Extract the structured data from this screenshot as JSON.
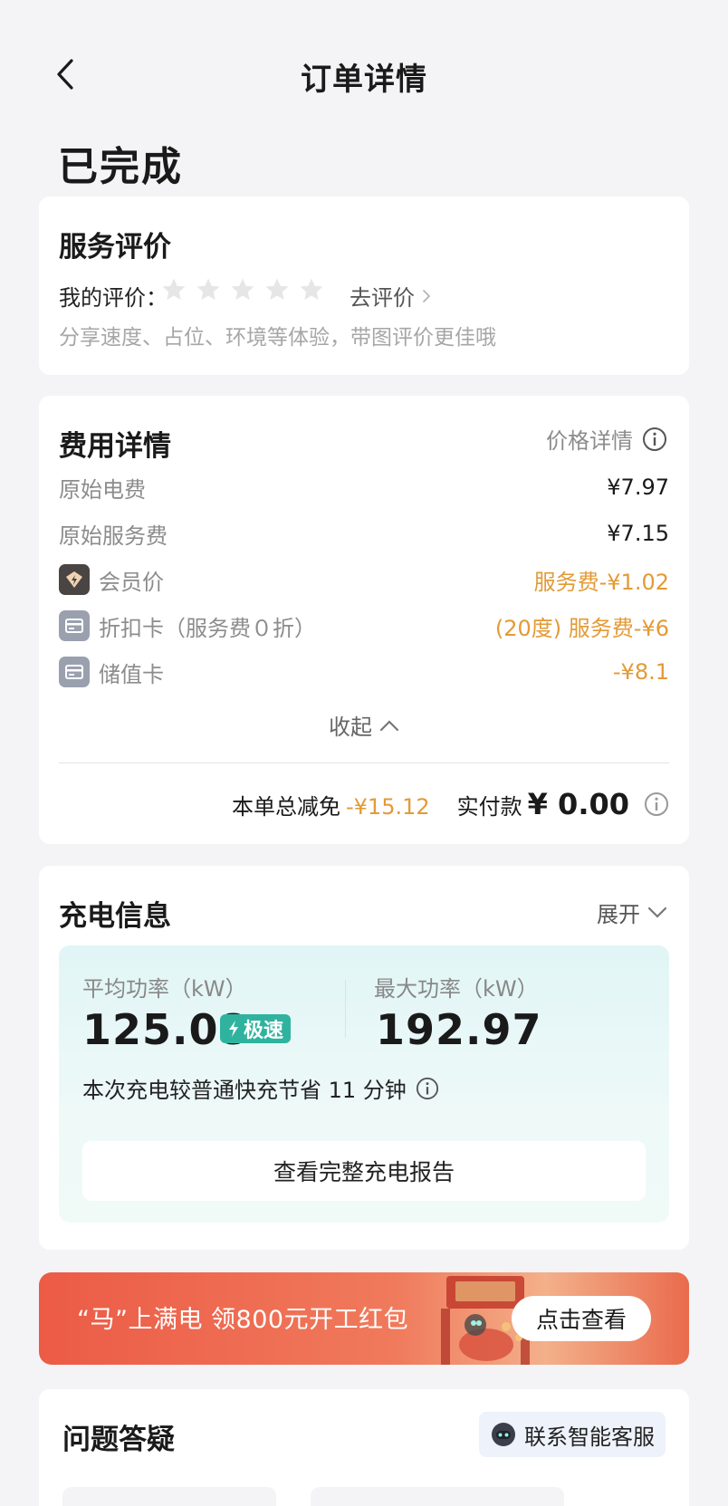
{
  "header": {
    "title": "订单详情"
  },
  "status": "已完成",
  "rating": {
    "title": "服务评价",
    "my_rating_label": "我的评价：",
    "stars": 0,
    "star_count": 5,
    "go_rate": "去评价",
    "hint": "分享速度、占位、环境等体验，带图评价更佳哦"
  },
  "fees": {
    "title": "费用详情",
    "price_detail": "价格详情",
    "rows": [
      {
        "label": "原始电费",
        "value": "¥7.97"
      },
      {
        "label": "原始服务费",
        "value": "¥7.15"
      },
      {
        "label": "会员价",
        "value": "服务费-¥1.02"
      },
      {
        "label": "折扣卡（服务费０折）",
        "value": "(20度) 服务费-¥6"
      },
      {
        "label": "储值卡",
        "value": "-¥8.1"
      }
    ],
    "collapse": "收起",
    "total_discount_label": "本单总减免",
    "total_discount_value": "-¥15.12",
    "paid_label": "实付款",
    "paid_value": "¥ 0.00",
    "colors": {
      "accent": "#e39a36"
    }
  },
  "charge": {
    "title": "充电信息",
    "expand": "展开",
    "avg_power_label": "平均功率（kW）",
    "avg_power_value": "125.08",
    "fast_badge": "极速",
    "max_power_label": "最大功率（kW）",
    "max_power_value": "192.97",
    "save_note": "本次充电较普通快充节省 11 分钟",
    "report_button": "查看完整充电报告"
  },
  "banner": {
    "text": "“马”上满电 领800元开工红包",
    "button": "点击查看"
  },
  "faq": {
    "title": "问题答疑",
    "service_button": "联系智能客服"
  }
}
